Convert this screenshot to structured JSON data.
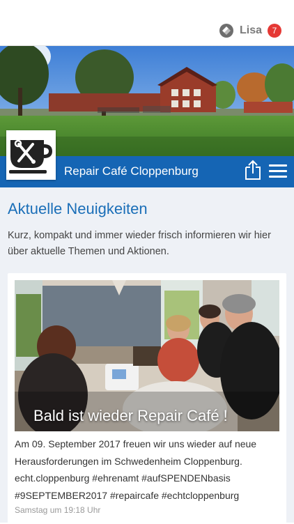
{
  "header": {
    "user_name": "Lisa",
    "notification_count": "7",
    "logo_icon": "app-logo-icon"
  },
  "page": {
    "title": "Repair Café Cloppenburg",
    "share_icon": "share-icon",
    "menu_icon": "hamburger-menu-icon",
    "profile_icon": "coffee-cup-tools-icon"
  },
  "news": {
    "heading": "Aktuelle Neuigkeiten",
    "description": "Kurz, kompakt und immer wieder frisch informieren wir hier über aktuelle Themen und Aktionen.",
    "posts": [
      {
        "image_caption": "Bald ist wieder Repair Café !",
        "text": "Am 09. September 2017 freuen wir uns wieder auf neue Herausforderungen im Schwedenheim Cloppenburg. echt.cloppenburg #ehrenamt #aufSPENDENbasis #9SEPTEMBER2017 #repaircafe #echtcloppenburg",
        "timestamp": "Samstag um 19:18 Uhr"
      }
    ]
  },
  "colors": {
    "brand_blue": "#1565b4",
    "heading_blue": "#1b6fb8",
    "badge_red": "#e53935"
  }
}
